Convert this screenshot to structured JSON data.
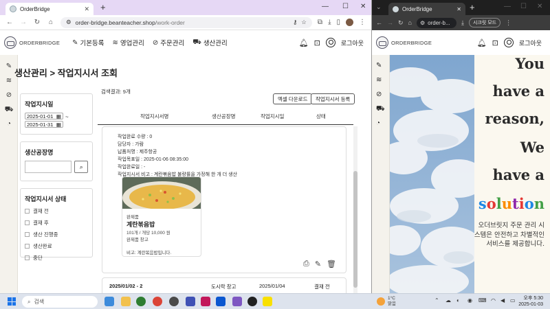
{
  "left_browser": {
    "tab_title": "OrderBridge",
    "url_domain": "order-bridge.beanteacher.shop",
    "url_path": "/work-order"
  },
  "header": {
    "logo_text": "ORDERBRIDGE",
    "nav": [
      "기본등록",
      "영업관리",
      "주문관리",
      "생산관리"
    ],
    "logout": "로그아웃"
  },
  "page": {
    "title": "생산관리 > 작업지시서 조회",
    "result_count": "검색결과: 9개",
    "excel_button": "엑셀 다운로드",
    "register_button": "작업지시서 등록"
  },
  "filters": {
    "date_title": "작업지시일",
    "date_from": "2025-01-01",
    "date_to": "2025-01-31",
    "date_sep": "~",
    "factory_title": "생산공장명",
    "status_title": "작업지시서 상태",
    "statuses": [
      "결재 전",
      "결재 후",
      "생산 진행중",
      "생산완료",
      "중단"
    ]
  },
  "table": {
    "headers": [
      "작업지시서명",
      "생산공장명",
      "작업지시일",
      "상태"
    ]
  },
  "detail": {
    "completed_qty": "작업완료 수량 : 0",
    "manager": "담당자 : 가람",
    "delivery": "납품처명 : 제주항공",
    "target_date": "작업목표일 : 2025-01-06 08:35:00",
    "completed_date": "작업완료일 : -",
    "note": "작업지시서 비고 : 계란볶음밥 불량률을 가정해 한 개 더 생산",
    "product": {
      "type": "완제품",
      "name": "계란볶음밥",
      "qty": "101개 / 개당 10,000 원",
      "warehouse": "완제품 창고",
      "memo": "비고: 계란볶음밥입니다."
    }
  },
  "next_row": {
    "name": "2025/01/02 - 2",
    "factory": "도시락 창고",
    "date": "2025/01/04",
    "status": "결재 전"
  },
  "right_browser": {
    "tab_title": "OrderBridge",
    "url_short": "order-b...",
    "secret_mode": "시크릿 모드",
    "logout": "로그아웃",
    "slogan_lines": [
      "You",
      "have a",
      "reason,",
      "We",
      "have a"
    ],
    "solution_letters": [
      "s",
      "o",
      "l",
      "u",
      "t",
      "i",
      "o",
      "n"
    ],
    "solution_colors": [
      "#1e88e5",
      "#e53935",
      "#43a047",
      "#fb8c00",
      "#8e24aa",
      "#e53935",
      "#1e88e5",
      "#43a047"
    ],
    "description": "오더브릿지 주문 관리 시스템은 안전하고 차별적인 서비스를 제공합니다."
  },
  "taskbar": {
    "search": "검색",
    "weather_temp": "1°C",
    "weather_desc": "맑음",
    "time": "오후 5:30",
    "date": "2025-01-03"
  }
}
